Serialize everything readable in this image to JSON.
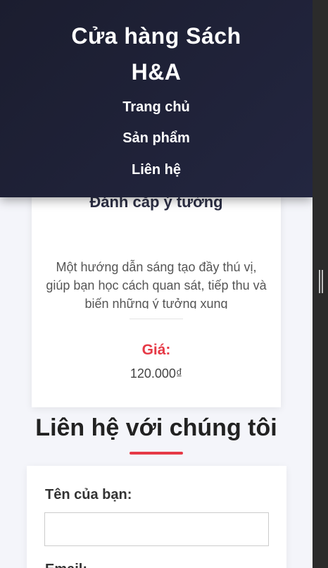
{
  "header": {
    "brand_line1": "Cửa hàng Sách",
    "brand_line2": "H&A",
    "nav": [
      {
        "label": "Trang chủ"
      },
      {
        "label": "Sản phẩm"
      },
      {
        "label": "Liên hệ"
      }
    ]
  },
  "product": {
    "title": "Đánh cắp ý tưởng",
    "description": "Một hướng dẫn sáng tạo đầy thú vị, giúp bạn học cách quan sát, tiếp thu và biến những ý tưởng xung",
    "price_label": "Giá:",
    "price_value": "120.000₫"
  },
  "contact": {
    "title": "Liên hệ với chúng tôi",
    "name_label": "Tên của bạn:",
    "name_value": "",
    "next_label": "Email:"
  },
  "colors": {
    "header_bg": "#1b1d2f",
    "accent": "#e63946",
    "page_bg": "#f4f5fa"
  }
}
